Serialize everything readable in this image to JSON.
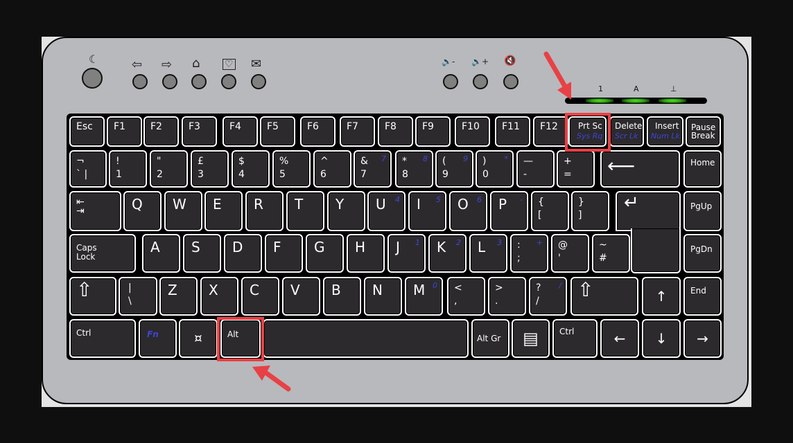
{
  "hotkeys": {
    "sleep": {
      "icon": "moon-icon",
      "glyph": "☾"
    },
    "items": [
      {
        "name": "back",
        "glyph": "⇦"
      },
      {
        "name": "forward",
        "glyph": "⇨"
      },
      {
        "name": "home",
        "glyph": "⌂"
      },
      {
        "name": "favorites",
        "glyph": "♡"
      },
      {
        "name": "mail",
        "glyph": "✉"
      }
    ],
    "volume": [
      {
        "name": "volume-down",
        "glyph": "🔈-"
      },
      {
        "name": "volume-up",
        "glyph": "🔈+"
      },
      {
        "name": "mute",
        "glyph": "🔇"
      }
    ]
  },
  "leds": {
    "labels": [
      "1",
      "A",
      "⊥"
    ],
    "color": "#4fd41a"
  },
  "highlight_color": "#e84145",
  "rows": {
    "fn": [
      "Esc",
      "F1",
      "F2",
      "F3",
      "F4",
      "F5",
      "F6",
      "F7",
      "F8",
      "F9",
      "F10",
      "F11",
      "F12"
    ],
    "prtsc": {
      "main": "Prt Sc",
      "alt": "Sys Rq"
    },
    "delete": {
      "main": "Delete",
      "alt": "Scr Lk"
    },
    "insert": {
      "main": "Insert",
      "alt": "Num Lk"
    },
    "pause": "Pause\nBreak",
    "num": [
      {
        "top": "¬",
        "bot": "`   |",
        "blue": ""
      },
      {
        "top": "!",
        "bot": "1",
        "blue": ""
      },
      {
        "top": "\"",
        "bot": "2",
        "blue": ""
      },
      {
        "top": "£",
        "bot": "3",
        "blue": ""
      },
      {
        "top": "$",
        "bot": "4",
        "blue": ""
      },
      {
        "top": "%",
        "bot": "5",
        "blue": ""
      },
      {
        "top": "^",
        "bot": "6",
        "blue": ""
      },
      {
        "top": "&",
        "bot": "7",
        "blue": "7"
      },
      {
        "top": "*",
        "bot": "8",
        "blue": "8"
      },
      {
        "top": "(",
        "bot": "9",
        "blue": "9"
      },
      {
        "top": ")",
        "bot": "0",
        "blue": "*"
      },
      {
        "top": "—",
        "bot": "-",
        "blue": ""
      },
      {
        "top": "+",
        "bot": "=",
        "blue": ""
      }
    ],
    "backspace": "⟵",
    "home": "Home",
    "tab": "⇤\n⇥",
    "qwerty": [
      {
        "k": "Q",
        "b": ""
      },
      {
        "k": "W",
        "b": ""
      },
      {
        "k": "E",
        "b": ""
      },
      {
        "k": "R",
        "b": ""
      },
      {
        "k": "T",
        "b": ""
      },
      {
        "k": "Y",
        "b": ""
      },
      {
        "k": "U",
        "b": "4"
      },
      {
        "k": "I",
        "b": "5"
      },
      {
        "k": "O",
        "b": "6"
      },
      {
        "k": "P",
        "b": "-"
      }
    ],
    "brackets": [
      {
        "top": "{",
        "bot": "["
      },
      {
        "top": "}",
        "bot": "]"
      }
    ],
    "enter": "↵",
    "pgup": "PgUp",
    "caps": "Caps\nLock",
    "asdf": [
      {
        "k": "A",
        "b": ""
      },
      {
        "k": "S",
        "b": ""
      },
      {
        "k": "D",
        "b": ""
      },
      {
        "k": "F",
        "b": ""
      },
      {
        "k": "G",
        "b": ""
      },
      {
        "k": "H",
        "b": ""
      },
      {
        "k": "J",
        "b": "1"
      },
      {
        "k": "K",
        "b": "2"
      },
      {
        "k": "L",
        "b": "3"
      }
    ],
    "semi": {
      "top": ":",
      "bot": ";",
      "blue": "+"
    },
    "quote": {
      "top": "@",
      "bot": "'"
    },
    "hash": {
      "top": "~",
      "bot": "#"
    },
    "pgdn": "PgDn",
    "shift": "⇧",
    "backslash": {
      "top": "|",
      "bot": "\\"
    },
    "zxcv": [
      {
        "k": "Z",
        "b": ""
      },
      {
        "k": "X",
        "b": ""
      },
      {
        "k": "C",
        "b": ""
      },
      {
        "k": "V",
        "b": ""
      },
      {
        "k": "B",
        "b": ""
      },
      {
        "k": "N",
        "b": ""
      },
      {
        "k": "M",
        "b": "0"
      }
    ],
    "comma": {
      "top": "<",
      "bot": ","
    },
    "period": {
      "top": ">",
      "bot": "."
    },
    "slash": {
      "top": "?",
      "bot": "/",
      "blue": "/"
    },
    "up": "↑",
    "end": "End",
    "ctrl": "Ctrl",
    "fn_key": "Fn",
    "super": "¤",
    "alt": "Alt",
    "altgr": "Alt Gr",
    "menu": "▤",
    "left": "←",
    "down": "↓",
    "right": "→"
  }
}
